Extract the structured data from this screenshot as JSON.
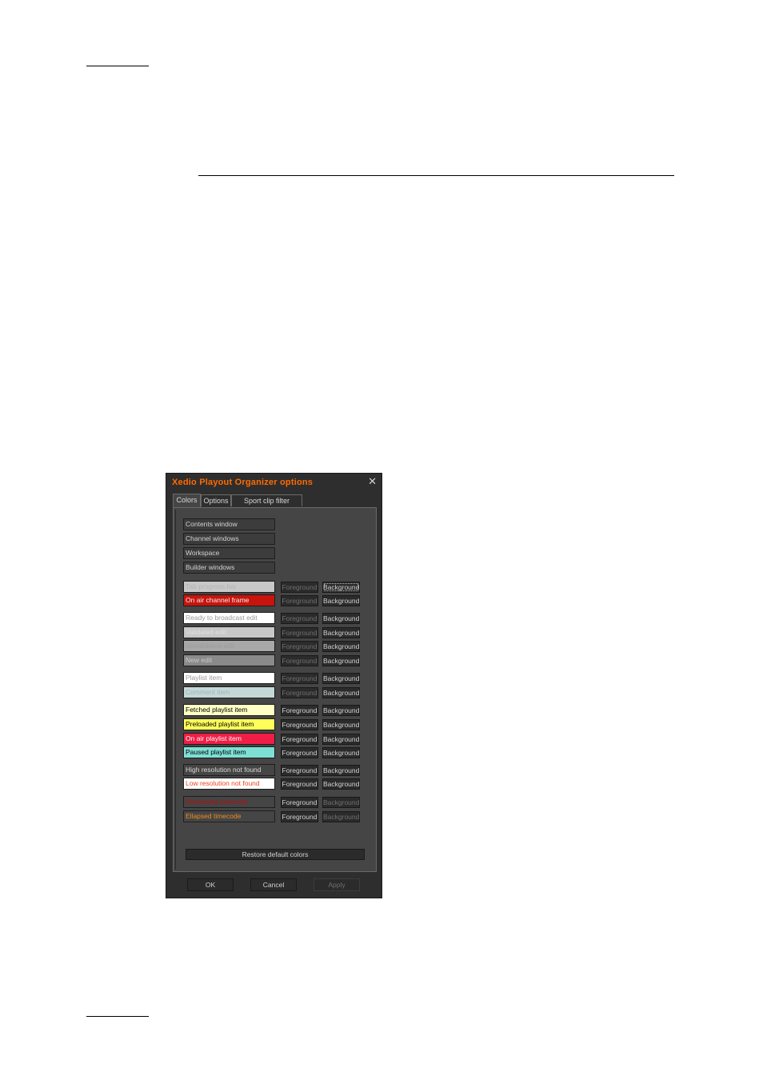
{
  "dialog": {
    "title": "Xedio Playout Organizer options",
    "close_glyph": "✕",
    "tabs": [
      {
        "label": "Colors",
        "active": true
      },
      {
        "label": "Options",
        "active": false
      },
      {
        "label": "Sport clip filter options",
        "active": false
      }
    ],
    "section_buttons": [
      "Contents window",
      "Channel windows",
      "Workspace",
      "Builder windows"
    ],
    "color_items": [
      {
        "label": "Tab progress bar",
        "bg": "#c8c8c8",
        "fg": "#b4b4b4",
        "fg_enabled": false,
        "bg_enabled": true
      },
      {
        "label": "On air channel frame",
        "bg": "#c8140c",
        "fg": "#f0f0f0",
        "fg_enabled": false,
        "bg_enabled": true
      },
      {
        "label": "Ready to broadcast edit",
        "bg": "#ffffff",
        "fg": "#9a9a9a",
        "fg_enabled": false,
        "bg_enabled": true
      },
      {
        "label": "Validated edit",
        "bg": "#c8c8c8",
        "fg": "#e0e0e0",
        "fg_enabled": false,
        "bg_enabled": true
      },
      {
        "label": "Unvalidated edit",
        "bg": "#a8a8a8",
        "fg": "#9c9c9c",
        "fg_enabled": false,
        "bg_enabled": true
      },
      {
        "label": "New edit",
        "bg": "#8a8a8a",
        "fg": "#c8c8c8",
        "fg_enabled": false,
        "bg_enabled": true
      },
      {
        "label": "Playlist item",
        "bg": "#ffffff",
        "fg": "#9a9a9a",
        "fg_enabled": false,
        "bg_enabled": true
      },
      {
        "label": "Comment item",
        "bg": "#c4d8d8",
        "fg": "#9eb6b6",
        "fg_enabled": false,
        "bg_enabled": true
      },
      {
        "label": "Fetched playlist item",
        "bg": "#ffffc4",
        "fg": "#000000",
        "fg_enabled": true,
        "bg_enabled": true
      },
      {
        "label": "Preloaded playlist item",
        "bg": "#ffff5a",
        "fg": "#000000",
        "fg_enabled": true,
        "bg_enabled": true
      },
      {
        "label": "On air playlist item",
        "bg": "#f01e46",
        "fg": "#ffffff",
        "fg_enabled": true,
        "bg_enabled": true
      },
      {
        "label": "Paused playlist item",
        "bg": "#7ee0d4",
        "fg": "#000000",
        "fg_enabled": true,
        "bg_enabled": true
      },
      {
        "label": "High resolution not found",
        "bg": "#454545",
        "fg": "#d8d8d8",
        "fg_enabled": true,
        "bg_enabled": true
      },
      {
        "label": "Low resolution not found",
        "bg": "#ffffff",
        "fg": "#e8461e",
        "fg_enabled": true,
        "bg_enabled": true
      },
      {
        "label": "Remaining timecode",
        "bg": "#454545",
        "fg": "#b01010",
        "fg_enabled": true,
        "bg_enabled": false
      },
      {
        "label": "Ellapsed timecode",
        "bg": "#454545",
        "fg": "#f08c1e",
        "fg_enabled": true,
        "bg_enabled": false
      }
    ],
    "foreground_label": "Foreground",
    "background_label": "Background",
    "restore_label": "Restore default colors",
    "ok_label": "OK",
    "cancel_label": "Cancel",
    "apply_label": "Apply"
  }
}
